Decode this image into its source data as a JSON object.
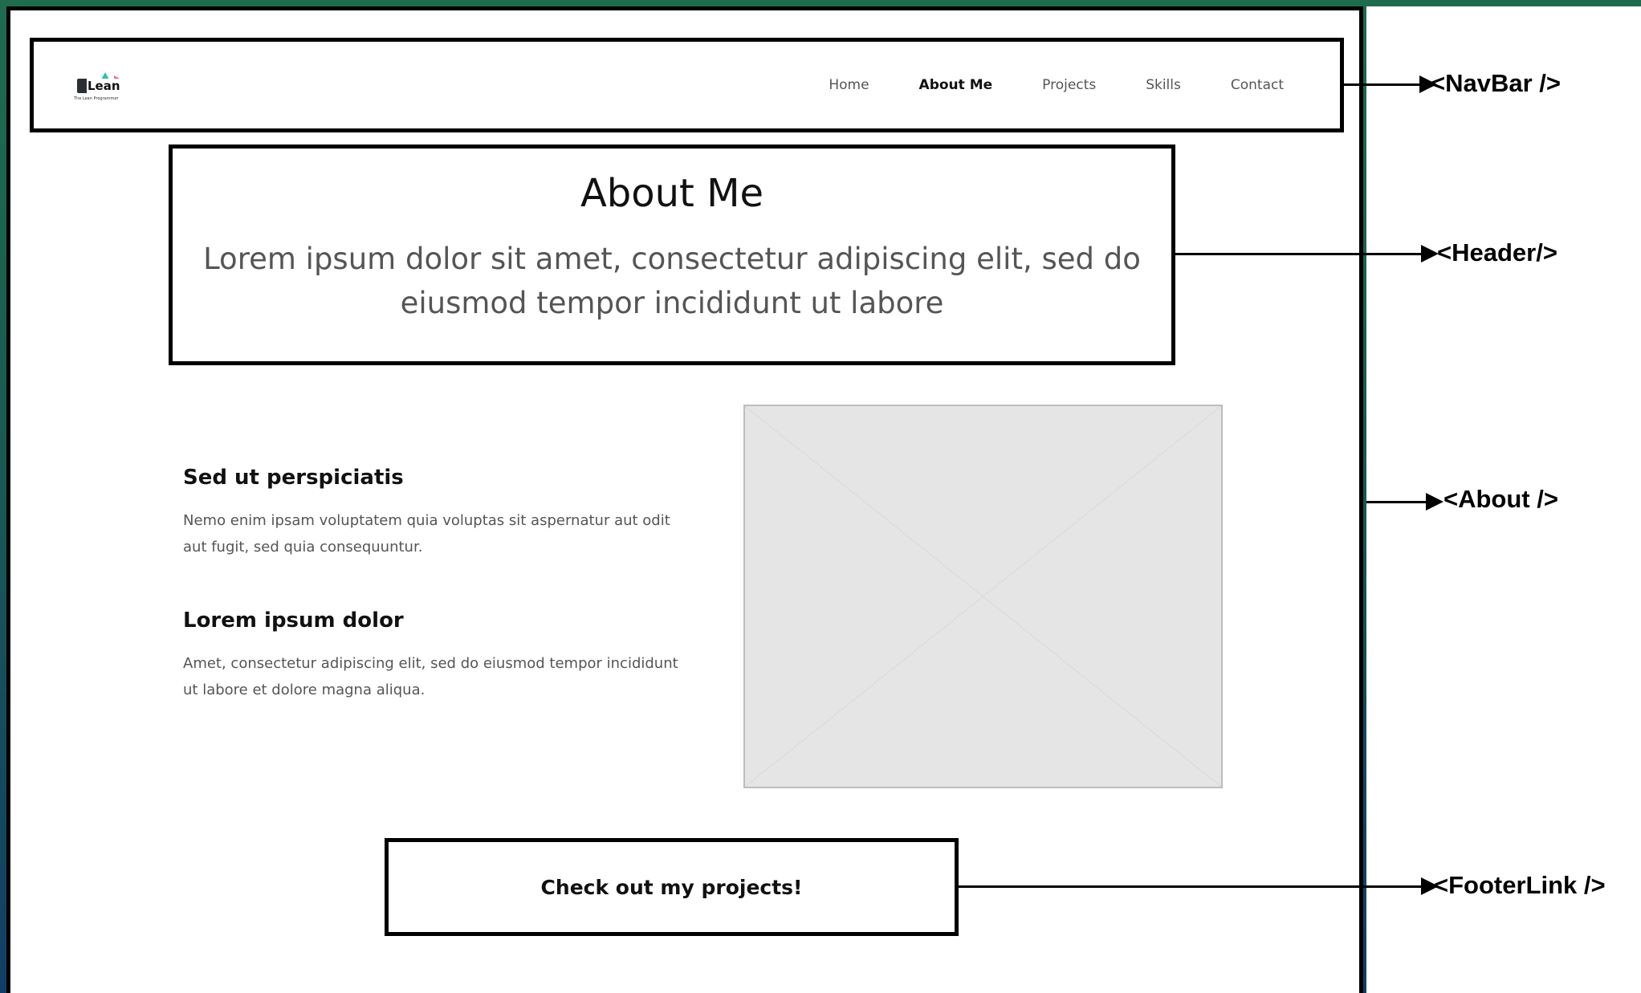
{
  "navbar": {
    "logo_word": "Lean",
    "logo_tagline": "The Lean Programmer",
    "links": [
      {
        "label": "Home",
        "active": false
      },
      {
        "label": "About Me",
        "active": true
      },
      {
        "label": "Projects",
        "active": false
      },
      {
        "label": "Skills",
        "active": false
      },
      {
        "label": "Contact",
        "active": false
      }
    ]
  },
  "header": {
    "title": "About Me",
    "subtitle": "Lorem ipsum dolor sit amet, consectetur adipiscing elit, sed do eiusmod tempor incididunt ut labore"
  },
  "about": {
    "sections": [
      {
        "heading": "Sed ut perspiciatis",
        "body": "Nemo enim ipsam voluptatem quia voluptas sit aspernatur aut odit aut fugit, sed quia consequuntur."
      },
      {
        "heading": "Lorem ipsum dolor",
        "body": "Amet, consectetur adipiscing elit, sed do eiusmod tempor incididunt ut labore et dolore magna aliqua."
      }
    ],
    "image_placeholder_icon": "image-placeholder-icon"
  },
  "footer_link": {
    "label": "Check out my projects!"
  },
  "annotations": {
    "navbar": "<NavBar />",
    "header": "<Header/>",
    "about": "<About />",
    "footer_link": "<FooterLink />"
  }
}
